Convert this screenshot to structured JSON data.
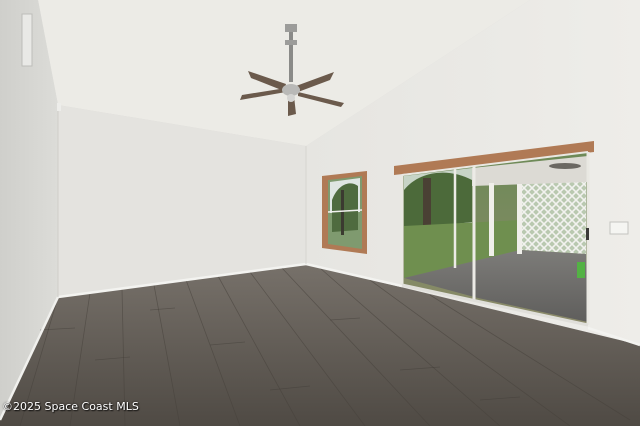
{
  "photo": {
    "watermark": "©2025 Space Coast MLS",
    "colors": {
      "ceiling": "#ecebe6",
      "wall_left": "#dadad6",
      "wall_back": "#e4e3df",
      "wall_right": "#e9e8e4",
      "floor": "#5f5a54",
      "door_frame": "#b07a55",
      "fan_body": "#6b5a4c"
    }
  }
}
